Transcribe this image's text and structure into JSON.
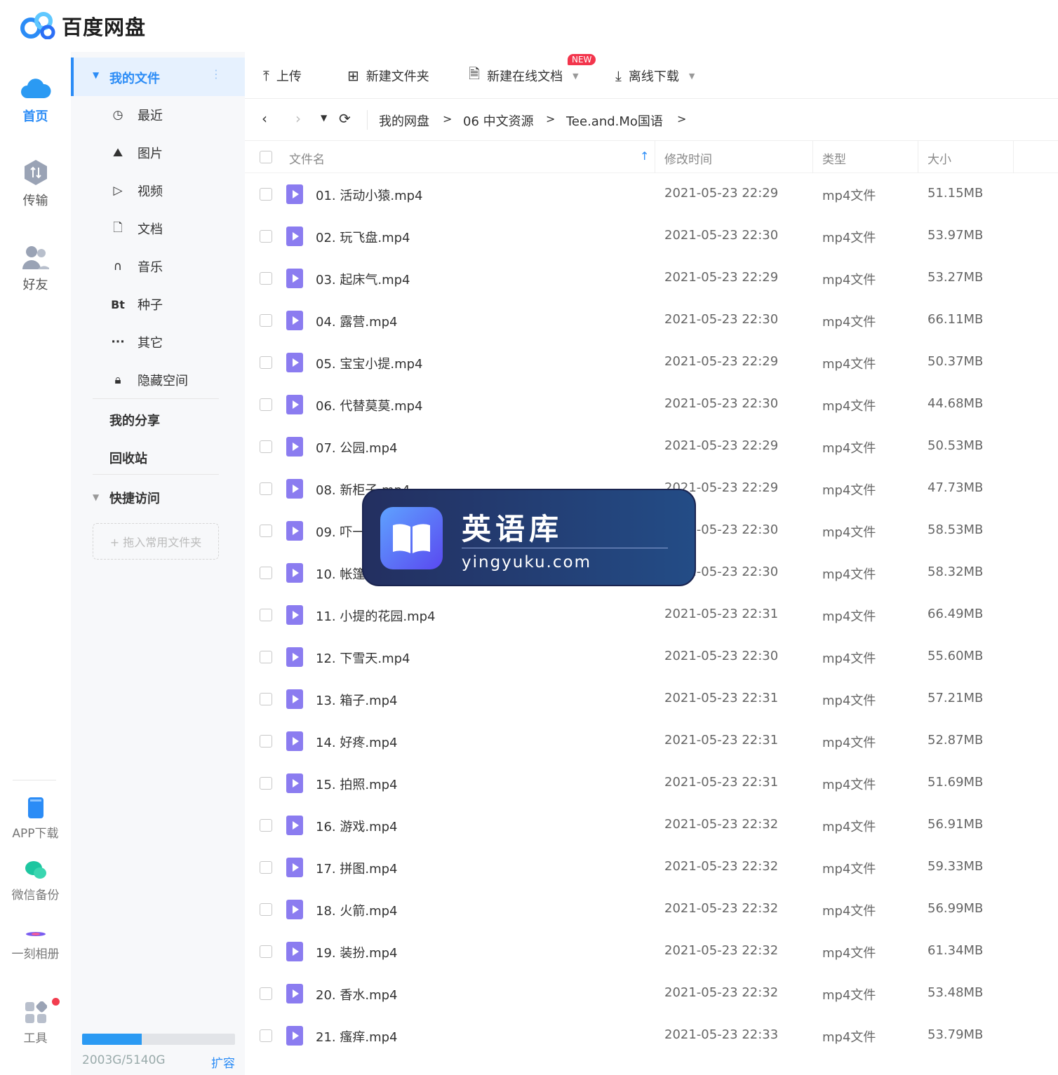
{
  "app": {
    "title": "百度网盘"
  },
  "rail": {
    "items": [
      {
        "label": "首页"
      },
      {
        "label": "传输"
      },
      {
        "label": "好友"
      }
    ],
    "bottom": [
      {
        "label": "APP下载"
      },
      {
        "label": "微信备份"
      },
      {
        "label": "一刻相册"
      },
      {
        "label": "工具"
      }
    ]
  },
  "sidebar": {
    "my_files": "我的文件",
    "categories": [
      {
        "icon": "clock-icon",
        "label": "最近"
      },
      {
        "icon": "image-icon",
        "label": "图片"
      },
      {
        "icon": "play-icon",
        "label": "视频"
      },
      {
        "icon": "doc-icon",
        "label": "文档"
      },
      {
        "icon": "headphones-icon",
        "label": "音乐"
      },
      {
        "icon": "bt-icon",
        "glyph": "Bt",
        "label": "种子"
      },
      {
        "icon": "more-icon",
        "glyph": "···",
        "label": "其它"
      },
      {
        "icon": "lock-icon",
        "label": "隐藏空间"
      }
    ],
    "my_share": "我的分享",
    "recycle": "回收站",
    "quick_access": "快捷访问",
    "quick_drop": "+ 拖入常用文件夹",
    "storage": {
      "text": "2003G/5140G",
      "used_fraction": 0.39,
      "expand": "扩容"
    }
  },
  "toolbar": {
    "upload": "上传",
    "new_folder": "新建文件夹",
    "new_doc": "新建在线文档",
    "new_badge": "NEW",
    "offline": "离线下载"
  },
  "breadcrumb": [
    "我的网盘",
    "06 中文资源",
    "Tee.and.Mo国语"
  ],
  "columns": {
    "name": "文件名",
    "time": "修改时间",
    "type": "类型",
    "size": "大小"
  },
  "files": [
    {
      "name": "01. 活动小猿.mp4",
      "time": "2021-05-23 22:29",
      "type": "mp4文件",
      "size": "51.15MB"
    },
    {
      "name": "02. 玩飞盘.mp4",
      "time": "2021-05-23 22:30",
      "type": "mp4文件",
      "size": "53.97MB"
    },
    {
      "name": "03. 起床气.mp4",
      "time": "2021-05-23 22:29",
      "type": "mp4文件",
      "size": "53.27MB"
    },
    {
      "name": "04. 露营.mp4",
      "time": "2021-05-23 22:30",
      "type": "mp4文件",
      "size": "66.11MB"
    },
    {
      "name": "05. 宝宝小提.mp4",
      "time": "2021-05-23 22:29",
      "type": "mp4文件",
      "size": "50.37MB"
    },
    {
      "name": "06. 代替莫莫.mp4",
      "time": "2021-05-23 22:30",
      "type": "mp4文件",
      "size": "44.68MB"
    },
    {
      "name": "07. 公园.mp4",
      "time": "2021-05-23 22:29",
      "type": "mp4文件",
      "size": "50.53MB"
    },
    {
      "name": "08. 新柜子.mp4",
      "time": "2021-05-23 22:29",
      "type": "mp4文件",
      "size": "47.73MB"
    },
    {
      "name": "09. 吓一跳.mp4",
      "time": "2021-05-23 22:30",
      "type": "mp4文件",
      "size": "58.53MB"
    },
    {
      "name": "10. 帐篷.mp4",
      "time": "2021-05-23 22:30",
      "type": "mp4文件",
      "size": "58.32MB"
    },
    {
      "name": "11. 小提的花园.mp4",
      "time": "2021-05-23 22:31",
      "type": "mp4文件",
      "size": "66.49MB"
    },
    {
      "name": "12. 下雪天.mp4",
      "time": "2021-05-23 22:30",
      "type": "mp4文件",
      "size": "55.60MB"
    },
    {
      "name": "13. 箱子.mp4",
      "time": "2021-05-23 22:31",
      "type": "mp4文件",
      "size": "57.21MB"
    },
    {
      "name": "14. 好疼.mp4",
      "time": "2021-05-23 22:31",
      "type": "mp4文件",
      "size": "52.87MB"
    },
    {
      "name": "15. 拍照.mp4",
      "time": "2021-05-23 22:31",
      "type": "mp4文件",
      "size": "51.69MB"
    },
    {
      "name": "16. 游戏.mp4",
      "time": "2021-05-23 22:32",
      "type": "mp4文件",
      "size": "56.91MB"
    },
    {
      "name": "17. 拼图.mp4",
      "time": "2021-05-23 22:32",
      "type": "mp4文件",
      "size": "59.33MB"
    },
    {
      "name": "18. 火箭.mp4",
      "time": "2021-05-23 22:32",
      "type": "mp4文件",
      "size": "56.99MB"
    },
    {
      "name": "19. 装扮.mp4",
      "time": "2021-05-23 22:32",
      "type": "mp4文件",
      "size": "61.34MB"
    },
    {
      "name": "20. 香水.mp4",
      "time": "2021-05-23 22:32",
      "type": "mp4文件",
      "size": "53.48MB"
    },
    {
      "name": "21. 瘙痒.mp4",
      "time": "2021-05-23 22:33",
      "type": "mp4文件",
      "size": "53.79MB"
    }
  ],
  "watermark": {
    "title": "英语库",
    "url": "yingyuku.com"
  },
  "colors": {
    "accent": "#2b8cf6",
    "file_icon": "#8b7cf0",
    "badge": "#f3354c"
  }
}
